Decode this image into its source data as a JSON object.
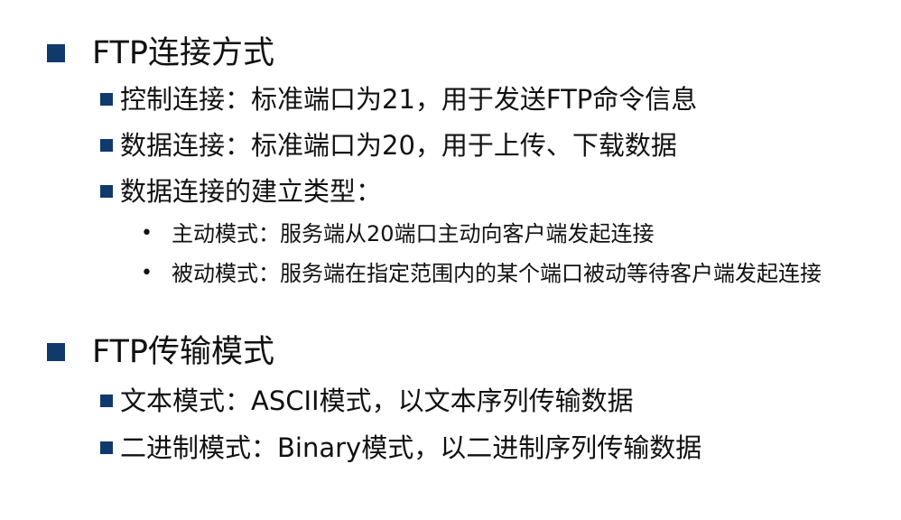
{
  "sections": [
    {
      "title": "FTP连接方式",
      "items": [
        "控制连接：标准端口为21，用于发送FTP命令信息",
        "数据连接：标准端口为20，用于上传、下载数据",
        "数据连接的建立类型："
      ],
      "subitems": [
        "主动模式：服务端从20端口主动向客户端发起连接",
        "被动模式：服务端在指定范围内的某个端口被动等待客户端发起连接"
      ]
    },
    {
      "title": "FTP传输模式",
      "items": [
        "文本模式：ASCII模式，以文本序列传输数据",
        "二进制模式：Binary模式，以二进制序列传输数据"
      ]
    }
  ],
  "colors": {
    "bullet": "#0f3a6b",
    "text": "#111111"
  },
  "icons": {
    "l1_bullet": "square-bullet-icon",
    "l2_bullet": "small-square-bullet-icon",
    "l3_bullet": "dot-bullet-icon"
  }
}
